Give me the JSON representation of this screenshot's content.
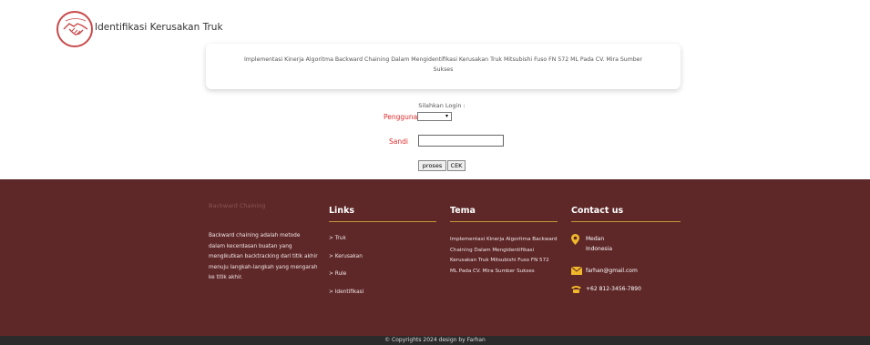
{
  "header": {
    "title": "Identifikasi Kerusakan Truk",
    "logo_icon": "handshake-icon",
    "accent": "#c94a4a"
  },
  "intro": {
    "text": "Implementasi Kinerja Algoritma Backward Chaining Dalam Mengidentifikasi Kerusakan Truk Mitsubishi Fuso FN 572 ML Pada CV. Mira Sumber Sukses"
  },
  "login": {
    "prompt": "Silahkan Login :",
    "user_label": "Pengguna",
    "user_value": "",
    "pass_label": "Sandi",
    "pass_value": "",
    "submit_label": "proses",
    "check_label": "CEK"
  },
  "footer": {
    "bg": "#5e2728",
    "about": {
      "title": "Backward Chaining",
      "text": "Backward chaining adalah metode dalam kecerdasan buatan yang mengikutkan backtracking dari titik akhir menuju langkah-langkah yang mengarah ke titik akhir."
    },
    "links": {
      "heading": "Links",
      "items": [
        "> Truk",
        "> Kerusakan",
        "> Rule",
        "> Identifikasi"
      ]
    },
    "tema": {
      "heading": "Tema",
      "text": "Implementasi Kinerja Algoritma Backward Chaining Dalam Mengidentifikasi Kerusakan Truk Mitsubishi Fuso FN 572 ML Pada CV. Mira Sumber Sukses"
    },
    "contact": {
      "heading": "Contact us",
      "location_line1": "Medan",
      "location_line2": "Indonesia",
      "email": "farhan@gmail.com",
      "phone": "+62 812-3456-7890",
      "icon_color": "#f0b82a"
    },
    "copyright": "© Copyrights 2024 design by Farhan"
  }
}
